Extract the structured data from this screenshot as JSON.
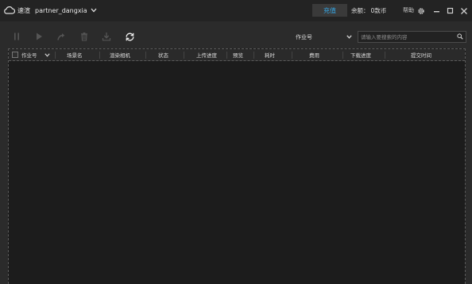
{
  "app": {
    "brand_name": "速渲",
    "account_name": "partner_dangxia"
  },
  "titlebar": {
    "recharge_label": "充值",
    "balance_label": "余额：",
    "balance_value": "0款币",
    "help_label": "帮助"
  },
  "toolbar": {
    "filter_select_value": "作业号",
    "search_placeholder": "请输入要搜索的内容"
  },
  "table": {
    "columns": [
      "作业号",
      "场景名",
      "渲染相机",
      "状态",
      "上传进度",
      "预览",
      "耗时",
      "费用",
      "下载进度",
      "提交时间"
    ],
    "rows": []
  },
  "colors": {
    "accent": "#35a7e6",
    "titlebar_bg": "#232323",
    "toolbar_bg": "#2b2b2b",
    "table_bg": "#1c1c1c"
  }
}
